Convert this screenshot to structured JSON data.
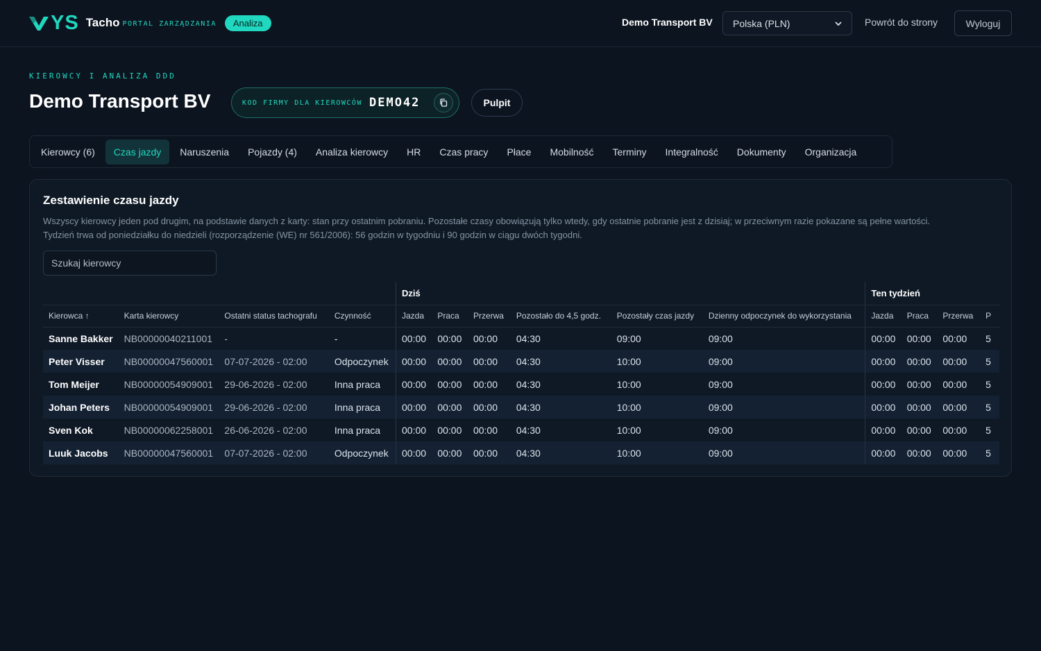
{
  "header": {
    "logo_text": "YS",
    "brand_title": "Tacho",
    "brand_sub": "PORTAL ZARZĄDZANIA",
    "badge": "Analiza",
    "company": "Demo Transport BV",
    "country_select": "Polska (PLN)",
    "back_link": "Powrót do strony",
    "logout": "Wyloguj"
  },
  "page": {
    "eyebrow": "KIEROWCY I ANALIZA DDD",
    "title": "Demo Transport BV",
    "code_label": "KOD FIRMY DLA KIEROWCÓW",
    "code_value": "DEMO42",
    "pulpit": "Pulpit"
  },
  "tabs": [
    {
      "label": "Kierowcy (6)"
    },
    {
      "label": "Czas jazdy"
    },
    {
      "label": "Naruszenia"
    },
    {
      "label": "Pojazdy (4)"
    },
    {
      "label": "Analiza kierowcy"
    },
    {
      "label": "HR"
    },
    {
      "label": "Czas pracy"
    },
    {
      "label": "Płace"
    },
    {
      "label": "Mobilność"
    },
    {
      "label": "Terminy"
    },
    {
      "label": "Integralność"
    },
    {
      "label": "Dokumenty"
    },
    {
      "label": "Organizacja"
    }
  ],
  "card": {
    "title": "Zestawienie czasu jazdy",
    "desc1": "Wszyscy kierowcy jeden pod drugim, na podstawie danych z karty: stan przy ostatnim pobraniu. Pozostałe czasy obowiązują tylko wtedy, gdy ostatnie pobranie jest z dzisiaj; w przeciwnym razie pokazane są pełne wartości.",
    "desc2": "Tydzień trwa od poniedziałku do niedzieli (rozporządzenie (WE) nr 561/2006): 56 godzin w tygodniu i 90 godzin w ciągu dwóch tygodni.",
    "search_placeholder": "Szukaj kierowcy"
  },
  "table": {
    "group_today": "Dziś",
    "group_week": "Ten tydzień",
    "columns": {
      "driver": "Kierowca ↑",
      "card": "Karta kierowcy",
      "status": "Ostatni status tachografu",
      "activity": "Czynność",
      "drive": "Jazda",
      "work": "Praca",
      "break": "Przerwa",
      "left45": "Pozostało do 4,5 godz.",
      "leftdrive": "Pozostały czas jazdy",
      "rest": "Dzienny odpoczynek do wykorzystania",
      "w_drive": "Jazda",
      "w_work": "Praca",
      "w_break": "Przerwa",
      "w_more": "P"
    },
    "rows": [
      {
        "name": "Sanne Bakker",
        "card": "NB00000040211001",
        "status": "-",
        "activity": "-",
        "drive": "00:00",
        "work": "00:00",
        "brk": "00:00",
        "left45": "04:30",
        "leftdrive": "09:00",
        "rest": "09:00",
        "w_drive": "00:00",
        "w_work": "00:00",
        "w_brk": "00:00",
        "w_more": "5"
      },
      {
        "name": "Peter Visser",
        "card": "NB00000047560001",
        "status": "07-07-2026 - 02:00",
        "activity": "Odpoczynek",
        "drive": "00:00",
        "work": "00:00",
        "brk": "00:00",
        "left45": "04:30",
        "leftdrive": "10:00",
        "rest": "09:00",
        "w_drive": "00:00",
        "w_work": "00:00",
        "w_brk": "00:00",
        "w_more": "5"
      },
      {
        "name": "Tom Meijer",
        "card": "NB00000054909001",
        "status": "29-06-2026 - 02:00",
        "activity": "Inna praca",
        "drive": "00:00",
        "work": "00:00",
        "brk": "00:00",
        "left45": "04:30",
        "leftdrive": "10:00",
        "rest": "09:00",
        "w_drive": "00:00",
        "w_work": "00:00",
        "w_brk": "00:00",
        "w_more": "5"
      },
      {
        "name": "Johan Peters",
        "card": "NB00000054909001",
        "status": "29-06-2026 - 02:00",
        "activity": "Inna praca",
        "drive": "00:00",
        "work": "00:00",
        "brk": "00:00",
        "left45": "04:30",
        "leftdrive": "10:00",
        "rest": "09:00",
        "w_drive": "00:00",
        "w_work": "00:00",
        "w_brk": "00:00",
        "w_more": "5"
      },
      {
        "name": "Sven Kok",
        "card": "NB00000062258001",
        "status": "26-06-2026 - 02:00",
        "activity": "Inna praca",
        "drive": "00:00",
        "work": "00:00",
        "brk": "00:00",
        "left45": "04:30",
        "leftdrive": "10:00",
        "rest": "09:00",
        "w_drive": "00:00",
        "w_work": "00:00",
        "w_brk": "00:00",
        "w_more": "5"
      },
      {
        "name": "Luuk Jacobs",
        "card": "NB00000047560001",
        "status": "07-07-2026 - 02:00",
        "activity": "Odpoczynek",
        "drive": "00:00",
        "work": "00:00",
        "brk": "00:00",
        "left45": "04:30",
        "leftdrive": "10:00",
        "rest": "09:00",
        "w_drive": "00:00",
        "w_work": "00:00",
        "w_brk": "00:00",
        "w_more": "5"
      }
    ]
  }
}
